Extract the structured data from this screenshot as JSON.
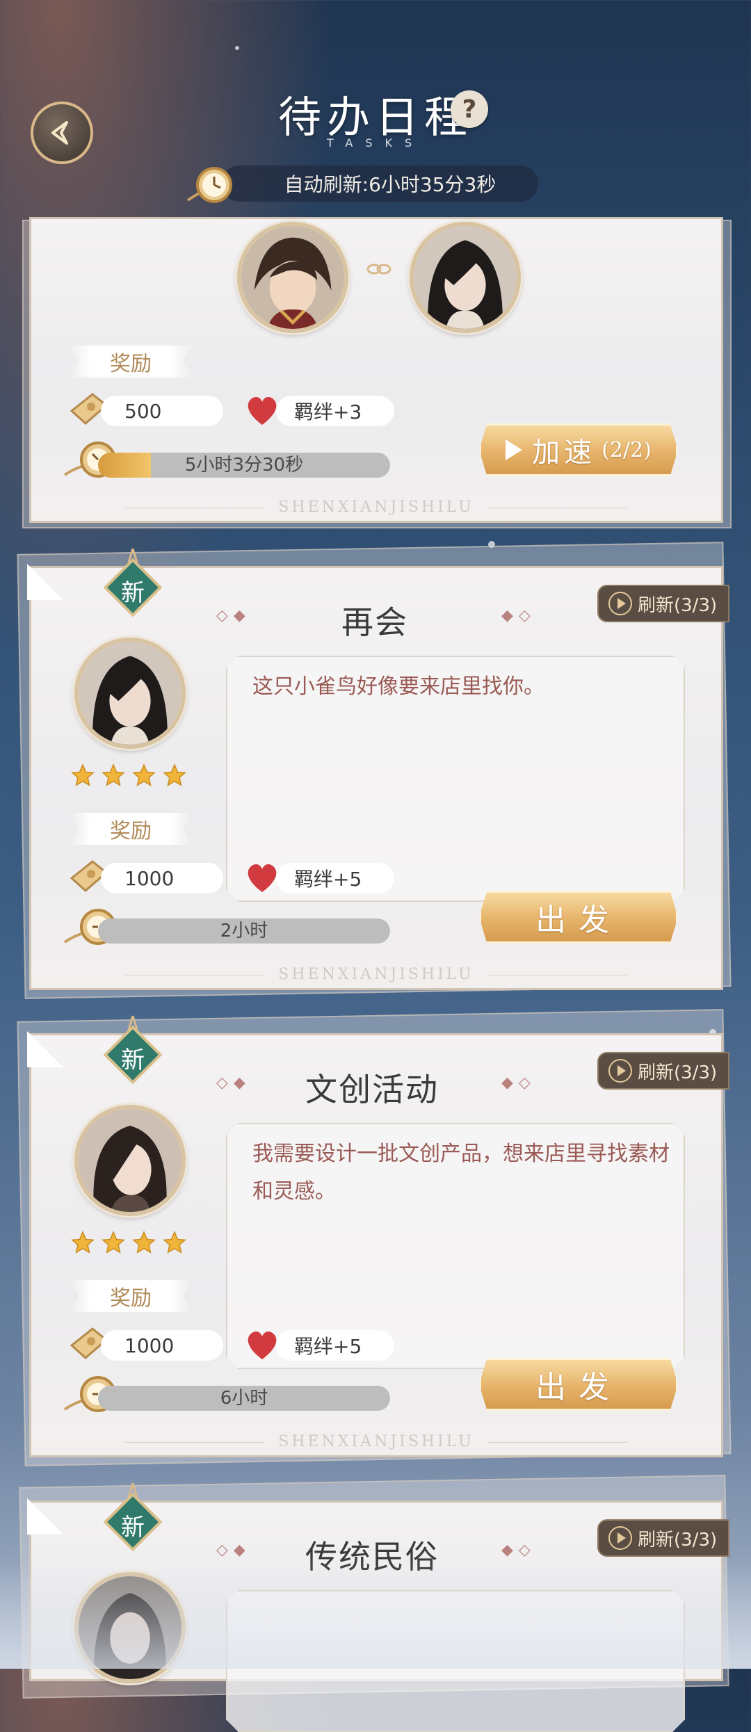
{
  "header": {
    "title": "待办日程",
    "subtitle": "TASKS",
    "help": "?",
    "auto_refresh": "自动刷新:6小时35分3秒"
  },
  "active_task": {
    "reward_label": "奖励",
    "coins": "500",
    "bond": "羁绊+3",
    "timer": "5小时3分30秒",
    "progress_fraction": 0.18,
    "button_label": "加速",
    "button_count": "(2/2)",
    "watermark": "SHENXIANJISHILU"
  },
  "missions": [
    {
      "badge": "新",
      "title": "再会",
      "refresh": "刷新(3/3)",
      "description": "这只小雀鸟好像要来店里找你。",
      "stars": 4,
      "reward_label": "奖励",
      "coins": "1000",
      "bond": "羁绊+5",
      "duration": "2小时",
      "button_label": "出发",
      "watermark": "SHENXIANJISHILU"
    },
    {
      "badge": "新",
      "title": "文创活动",
      "refresh": "刷新(3/3)",
      "description": "我需要设计一批文创产品，想来店里寻找素材和灵感。",
      "stars": 4,
      "reward_label": "奖励",
      "coins": "1000",
      "bond": "羁绊+5",
      "duration": "6小时",
      "button_label": "出发",
      "watermark": "SHENXIANJISHILU"
    },
    {
      "badge": "新",
      "title": "传统民俗",
      "refresh": "刷新(3/3)"
    }
  ],
  "colors": {
    "accent_gold": "#e6b36a",
    "reward_text": "#b08a57",
    "description_text": "#9a5a55",
    "badge_green": "#2f7a6b"
  }
}
